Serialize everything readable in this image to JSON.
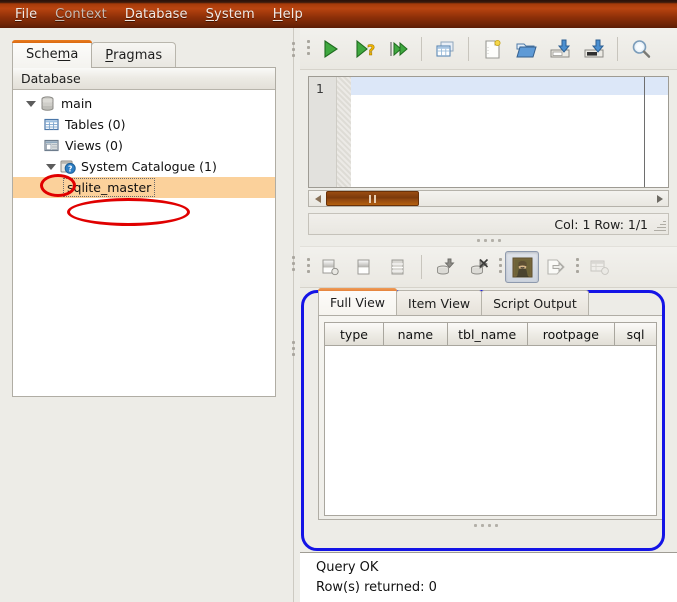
{
  "menubar": {
    "items": [
      {
        "label": "File",
        "mnemonic": "F",
        "dim": false
      },
      {
        "label": "Context",
        "mnemonic": "C",
        "dim": true
      },
      {
        "label": "Database",
        "mnemonic": "D",
        "dim": false
      },
      {
        "label": "System",
        "mnemonic": "S",
        "dim": false
      },
      {
        "label": "Help",
        "mnemonic": "H",
        "dim": false
      }
    ]
  },
  "left": {
    "tabs": [
      {
        "label": "Schema",
        "active": true
      },
      {
        "label": "Pragmas",
        "active": false
      }
    ],
    "tree_header": "Database",
    "tree": [
      {
        "label": "main",
        "icon": "database-icon",
        "level": 1,
        "twisty": "expanded",
        "selected": false
      },
      {
        "label": "Tables (0)",
        "icon": "tables-icon",
        "level": 2,
        "twisty": "none",
        "selected": false
      },
      {
        "label": "Views (0)",
        "icon": "views-icon",
        "level": 2,
        "twisty": "none",
        "selected": false
      },
      {
        "label": "System Catalogue (1)",
        "icon": "system-catalogue-icon",
        "level": 2,
        "twisty": "expanded",
        "selected": false
      },
      {
        "label": "sqlite_master",
        "icon": "none",
        "level": 3,
        "twisty": "none",
        "selected": true
      }
    ]
  },
  "toolbar_top": {
    "buttons": [
      {
        "name": "execute-query-button",
        "icon": "green-play-icon"
      },
      {
        "name": "explain-query-button",
        "icon": "play-question-icon"
      },
      {
        "name": "execute-step-button",
        "icon": "step-into-icon"
      },
      {
        "name": "show-results-grid-button",
        "icon": "grid-window-icon"
      },
      {
        "name": "new-file-button",
        "icon": "new-document-icon"
      },
      {
        "name": "open-file-button",
        "icon": "open-folder-icon"
      },
      {
        "name": "save-file-button",
        "icon": "save-disk-icon"
      },
      {
        "name": "save-as-button",
        "icon": "save-as-disk-icon"
      },
      {
        "name": "find-button",
        "icon": "magnifier-icon"
      }
    ]
  },
  "toolbar_bottom": {
    "buttons": [
      {
        "name": "insert-record-button",
        "icon": "add-row-icon"
      },
      {
        "name": "duplicate-record-button",
        "icon": "duplicate-row-icon"
      },
      {
        "name": "rows-button",
        "icon": "rows-icon"
      },
      {
        "name": "commit-button",
        "icon": "db-down-icon"
      },
      {
        "name": "rollback-button",
        "icon": "db-delete-icon"
      },
      {
        "name": "image-preview-button",
        "icon": "image-preview-icon",
        "pressed": true
      },
      {
        "name": "export-data-button",
        "icon": "export-arrow-icon"
      },
      {
        "name": "grid-settings-button",
        "icon": "grid-settings-icon",
        "disabled": true
      }
    ]
  },
  "editor": {
    "line_number": "1",
    "text": "",
    "status": "Col: 1 Row: 1/1"
  },
  "result": {
    "tabs": [
      {
        "label": "Full View",
        "active": true
      },
      {
        "label": "Item View",
        "active": false
      },
      {
        "label": "Script Output",
        "active": false
      }
    ],
    "columns": [
      "type",
      "name",
      "tbl_name",
      "rootpage",
      "sql"
    ],
    "rows": []
  },
  "log": {
    "lines": [
      "Query OK",
      "Row(s) returned: 0"
    ]
  },
  "colors": {
    "menubar_accent": "#a53a09",
    "selection": "#fbd19b",
    "annotation_red": "#e00000",
    "annotation_blue": "#1414e6",
    "tab_active_top": "#e87c20",
    "code_line_highlight": "#dce7f8",
    "scrollbar_thumb": "#8e4510"
  }
}
